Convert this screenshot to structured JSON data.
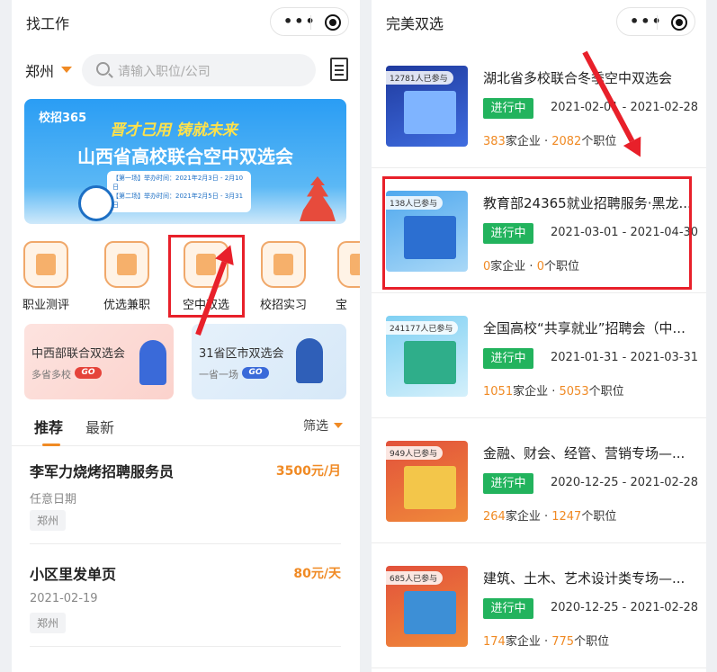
{
  "left": {
    "title": "找工作",
    "city": "郑州",
    "search_placeholder": "请输入职位/公司",
    "banner": {
      "logo": "校招365",
      "slogan": "晋才己用 铸就未来",
      "title": "山西省高校联合空中双选会",
      "schedule_1": "【第一场】举办时间：2021年2月3日 - 2月10日",
      "schedule_2": "【第二场】举办时间：2021年2月5日 - 3月31日"
    },
    "categories": [
      {
        "label": "职业测评"
      },
      {
        "label": "优选兼职"
      },
      {
        "label": "空中双选"
      },
      {
        "label": "校招实习"
      },
      {
        "label": "宝"
      }
    ],
    "promos": [
      {
        "title": "中西部联合双选会",
        "subtitle": "多省多校",
        "go": "GO"
      },
      {
        "title": "31省区市双选会",
        "subtitle": "一省一场",
        "go": "GO"
      }
    ],
    "tabs": {
      "recommend": "推荐",
      "newest": "最新",
      "filter": "筛选"
    },
    "jobs": [
      {
        "title": "李军力烧烤招聘服务员",
        "salary": "3500元/月",
        "date": "任意日期",
        "city": "郑州"
      },
      {
        "title": "小区里发单页",
        "salary": "80元/天",
        "date": "2021-02-19",
        "city": "郑州"
      }
    ]
  },
  "right": {
    "title": "完美双选",
    "fairs": [
      {
        "participants": "12781人已参与",
        "title": "湖北省多校联合冬季空中双选会",
        "status": "进行中",
        "dates": "2021-02-01 - 2021-02-28",
        "companies": "383",
        "companies_unit": "家企业 · ",
        "positions": "2082",
        "positions_unit": "个职位"
      },
      {
        "participants": "138人已参与",
        "title": "教育部24365就业招聘服务·黑龙...",
        "status": "进行中",
        "dates": "2021-03-01 - 2021-04-30",
        "companies": "0",
        "companies_unit": "家企业 · ",
        "positions": "0",
        "positions_unit": "个职位"
      },
      {
        "participants": "241177人已参与",
        "title": "全国高校“共享就业”招聘会（中...",
        "status": "进行中",
        "dates": "2021-01-31 - 2021-03-31",
        "companies": "1051",
        "companies_unit": "家企业 · ",
        "positions": "5053",
        "positions_unit": "个职位"
      },
      {
        "participants": "949人已参与",
        "title": "金融、财会、经管、营销专场—...",
        "status": "进行中",
        "dates": "2020-12-25 - 2021-02-28",
        "companies": "264",
        "companies_unit": "家企业 · ",
        "positions": "1247",
        "positions_unit": "个职位"
      },
      {
        "participants": "685人已参与",
        "title": "建筑、土木、艺术设计类专场—...",
        "status": "进行中",
        "dates": "2020-12-25 - 2021-02-28",
        "companies": "174",
        "companies_unit": "家企业 · ",
        "positions": "775",
        "positions_unit": "个职位"
      }
    ]
  },
  "colors": {
    "accent": "#f08a24",
    "status_green": "#22b35d",
    "highlight_red": "#e8202a"
  },
  "icons": [
    "more-dots-icon",
    "record-icon",
    "search-icon",
    "resume-doc-icon",
    "caret-down-icon"
  ]
}
